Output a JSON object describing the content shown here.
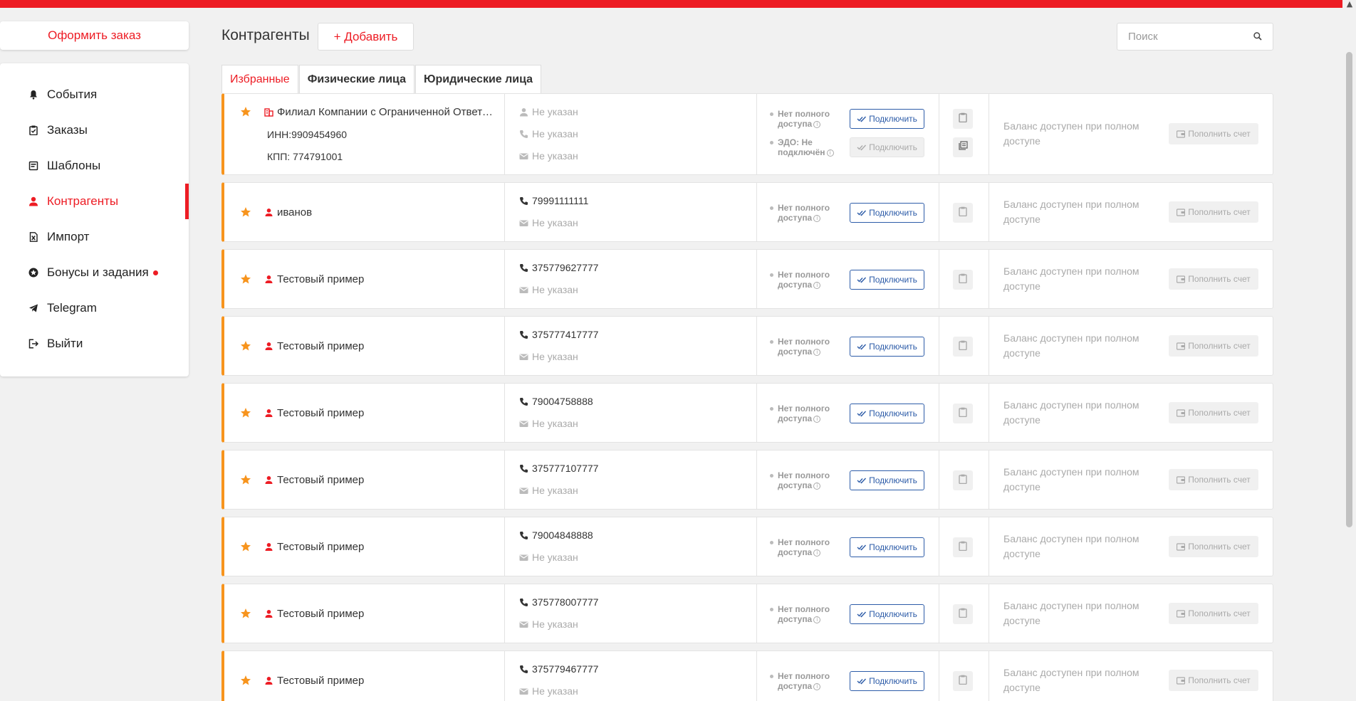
{
  "colors": {
    "brand": "#ed1c24",
    "accent_left": "#f7941d",
    "link_blue": "#2d5ca8"
  },
  "header": {
    "order_button": "Оформить заказ",
    "page_title": "Контрагенты",
    "add_button": "+ Добавить",
    "search_placeholder": "Поиск"
  },
  "sidebar": {
    "items": [
      {
        "label": "События",
        "icon": "bell-icon"
      },
      {
        "label": "Заказы",
        "icon": "clipboard-check-icon"
      },
      {
        "label": "Шаблоны",
        "icon": "template-icon"
      },
      {
        "label": "Контрагенты",
        "icon": "user-icon",
        "active": true
      },
      {
        "label": "Импорт",
        "icon": "excel-file-icon"
      },
      {
        "label": "Бонусы и задания",
        "icon": "star-badge-icon",
        "badge": true
      },
      {
        "label": "Telegram",
        "icon": "telegram-icon"
      },
      {
        "label": "Выйти",
        "icon": "logout-icon"
      }
    ]
  },
  "tabs": [
    {
      "label": "Избранные",
      "active": true
    },
    {
      "label": "Физические лица"
    },
    {
      "label": "Юридические лица"
    }
  ],
  "labels": {
    "no_full_access": "Нет полного доступа",
    "edo_not_connected": "ЭДО: Не подключён",
    "connect": "Подключить",
    "balance_text": "Баланс доступен при полном доступе",
    "topup": "Пополнить счет",
    "not_specified": "Не указан"
  },
  "company_row": {
    "name": "Филиал Компании с Ограниченной Ответственностью",
    "inn": "ИНН:9909454960",
    "kpp": "КПП: 774791001",
    "contact_person": "Не указан",
    "phone": "Не указан",
    "email": "Не указан"
  },
  "person_rows": [
    {
      "name": "иванов",
      "phone": "79991111111",
      "email": "Не указан"
    },
    {
      "name": "Тестовый пример",
      "phone": "375779627777",
      "email": "Не указан"
    },
    {
      "name": "Тестовый пример",
      "phone": "375777417777",
      "email": "Не указан"
    },
    {
      "name": "Тестовый пример",
      "phone": "79004758888",
      "email": "Не указан"
    },
    {
      "name": "Тестовый пример",
      "phone": "375777107777",
      "email": "Не указан"
    },
    {
      "name": "Тестовый пример",
      "phone": "79004848888",
      "email": "Не указан"
    },
    {
      "name": "Тестовый пример",
      "phone": "375778007777",
      "email": "Не указан"
    },
    {
      "name": "Тестовый пример",
      "phone": "375779467777",
      "email": "Не указан"
    }
  ]
}
